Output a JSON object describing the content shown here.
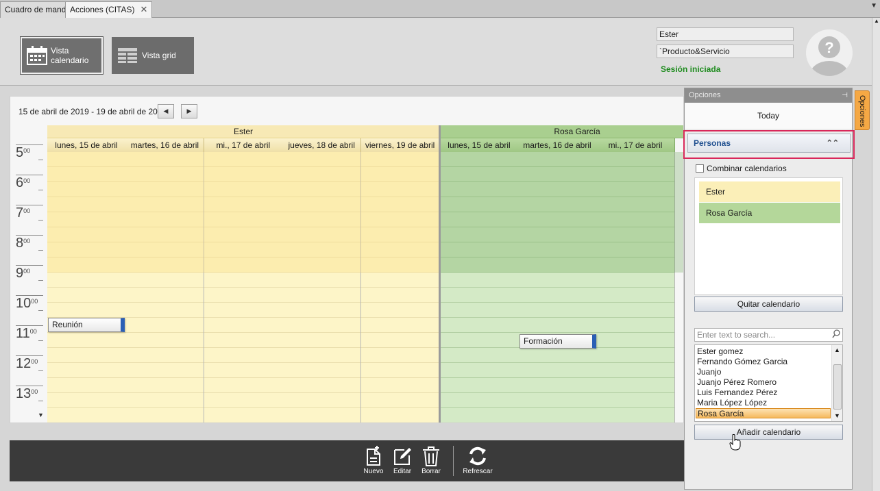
{
  "tabs": [
    {
      "label": "Cuadro de mando"
    },
    {
      "label": "Acciones (CITAS)",
      "close": "✕"
    }
  ],
  "header": {
    "views": [
      {
        "label": "Vista calendario",
        "icon": "calendar-icon",
        "active": true
      },
      {
        "label": "Vista grid",
        "icon": "grid-icon",
        "active": false
      }
    ],
    "user_field": "Ester",
    "product_field": "`Producto&Servicio",
    "session_status": "Sesión iniciada",
    "avatar_icon": "unknown-user-avatar-icon"
  },
  "calendar": {
    "date_range": "15 de abril de 2019 - 19 de abril de 2019",
    "resources": [
      {
        "name": "Ester",
        "color": "#f7e9b5",
        "days": [
          "lunes, 15 de abril",
          "martes, 16 de abril",
          "mi., 17 de abril",
          "jueves, 18 de abril",
          "viernes, 19 de abril"
        ]
      },
      {
        "name": "Rosa García",
        "color": "#a9cf8f",
        "days": [
          "lunes, 15 de abril",
          "martes, 16 de abril",
          "mi., 17 de abril"
        ]
      }
    ],
    "hours": [
      "5",
      "6",
      "7",
      "8",
      "9",
      "10",
      "11",
      "12",
      "13"
    ],
    "minutes": "00",
    "appointments": [
      {
        "subject": "Reunión",
        "resource": "Ester",
        "day": "lunes, 15 de abril",
        "start": "10:00"
      },
      {
        "subject": "Formación",
        "resource": "Rosa García",
        "day": "martes, 16 de abril",
        "start": "10:30"
      }
    ]
  },
  "toolbar": {
    "buttons": [
      {
        "label": "Nuevo",
        "icon": "new-document-icon"
      },
      {
        "label": "Editar",
        "icon": "edit-icon"
      },
      {
        "label": "Borrar",
        "icon": "trash-icon"
      },
      {
        "label": "Refrescar",
        "icon": "refresh-icon"
      }
    ]
  },
  "options": {
    "title": "Opciones",
    "tab_label": "Opciones",
    "today": "Today",
    "personas": "Personas",
    "combine_label": "Combinar calendarios",
    "calendars": [
      {
        "name": "Ester",
        "color": "#fbefb8"
      },
      {
        "name": "Rosa García",
        "color": "#b4d79a"
      }
    ],
    "remove_btn": "Quitar calendario",
    "search_placeholder": "Enter text to search...",
    "people": [
      "Ester gomez",
      "Fernando Gómez Garcia",
      "Juanjo",
      "Juanjo Pérez Romero",
      "Luis Fernandez Pérez",
      "Maria López López",
      "Rosa García"
    ],
    "selected_person": "Rosa García",
    "add_btn": "Añadir calendario"
  }
}
